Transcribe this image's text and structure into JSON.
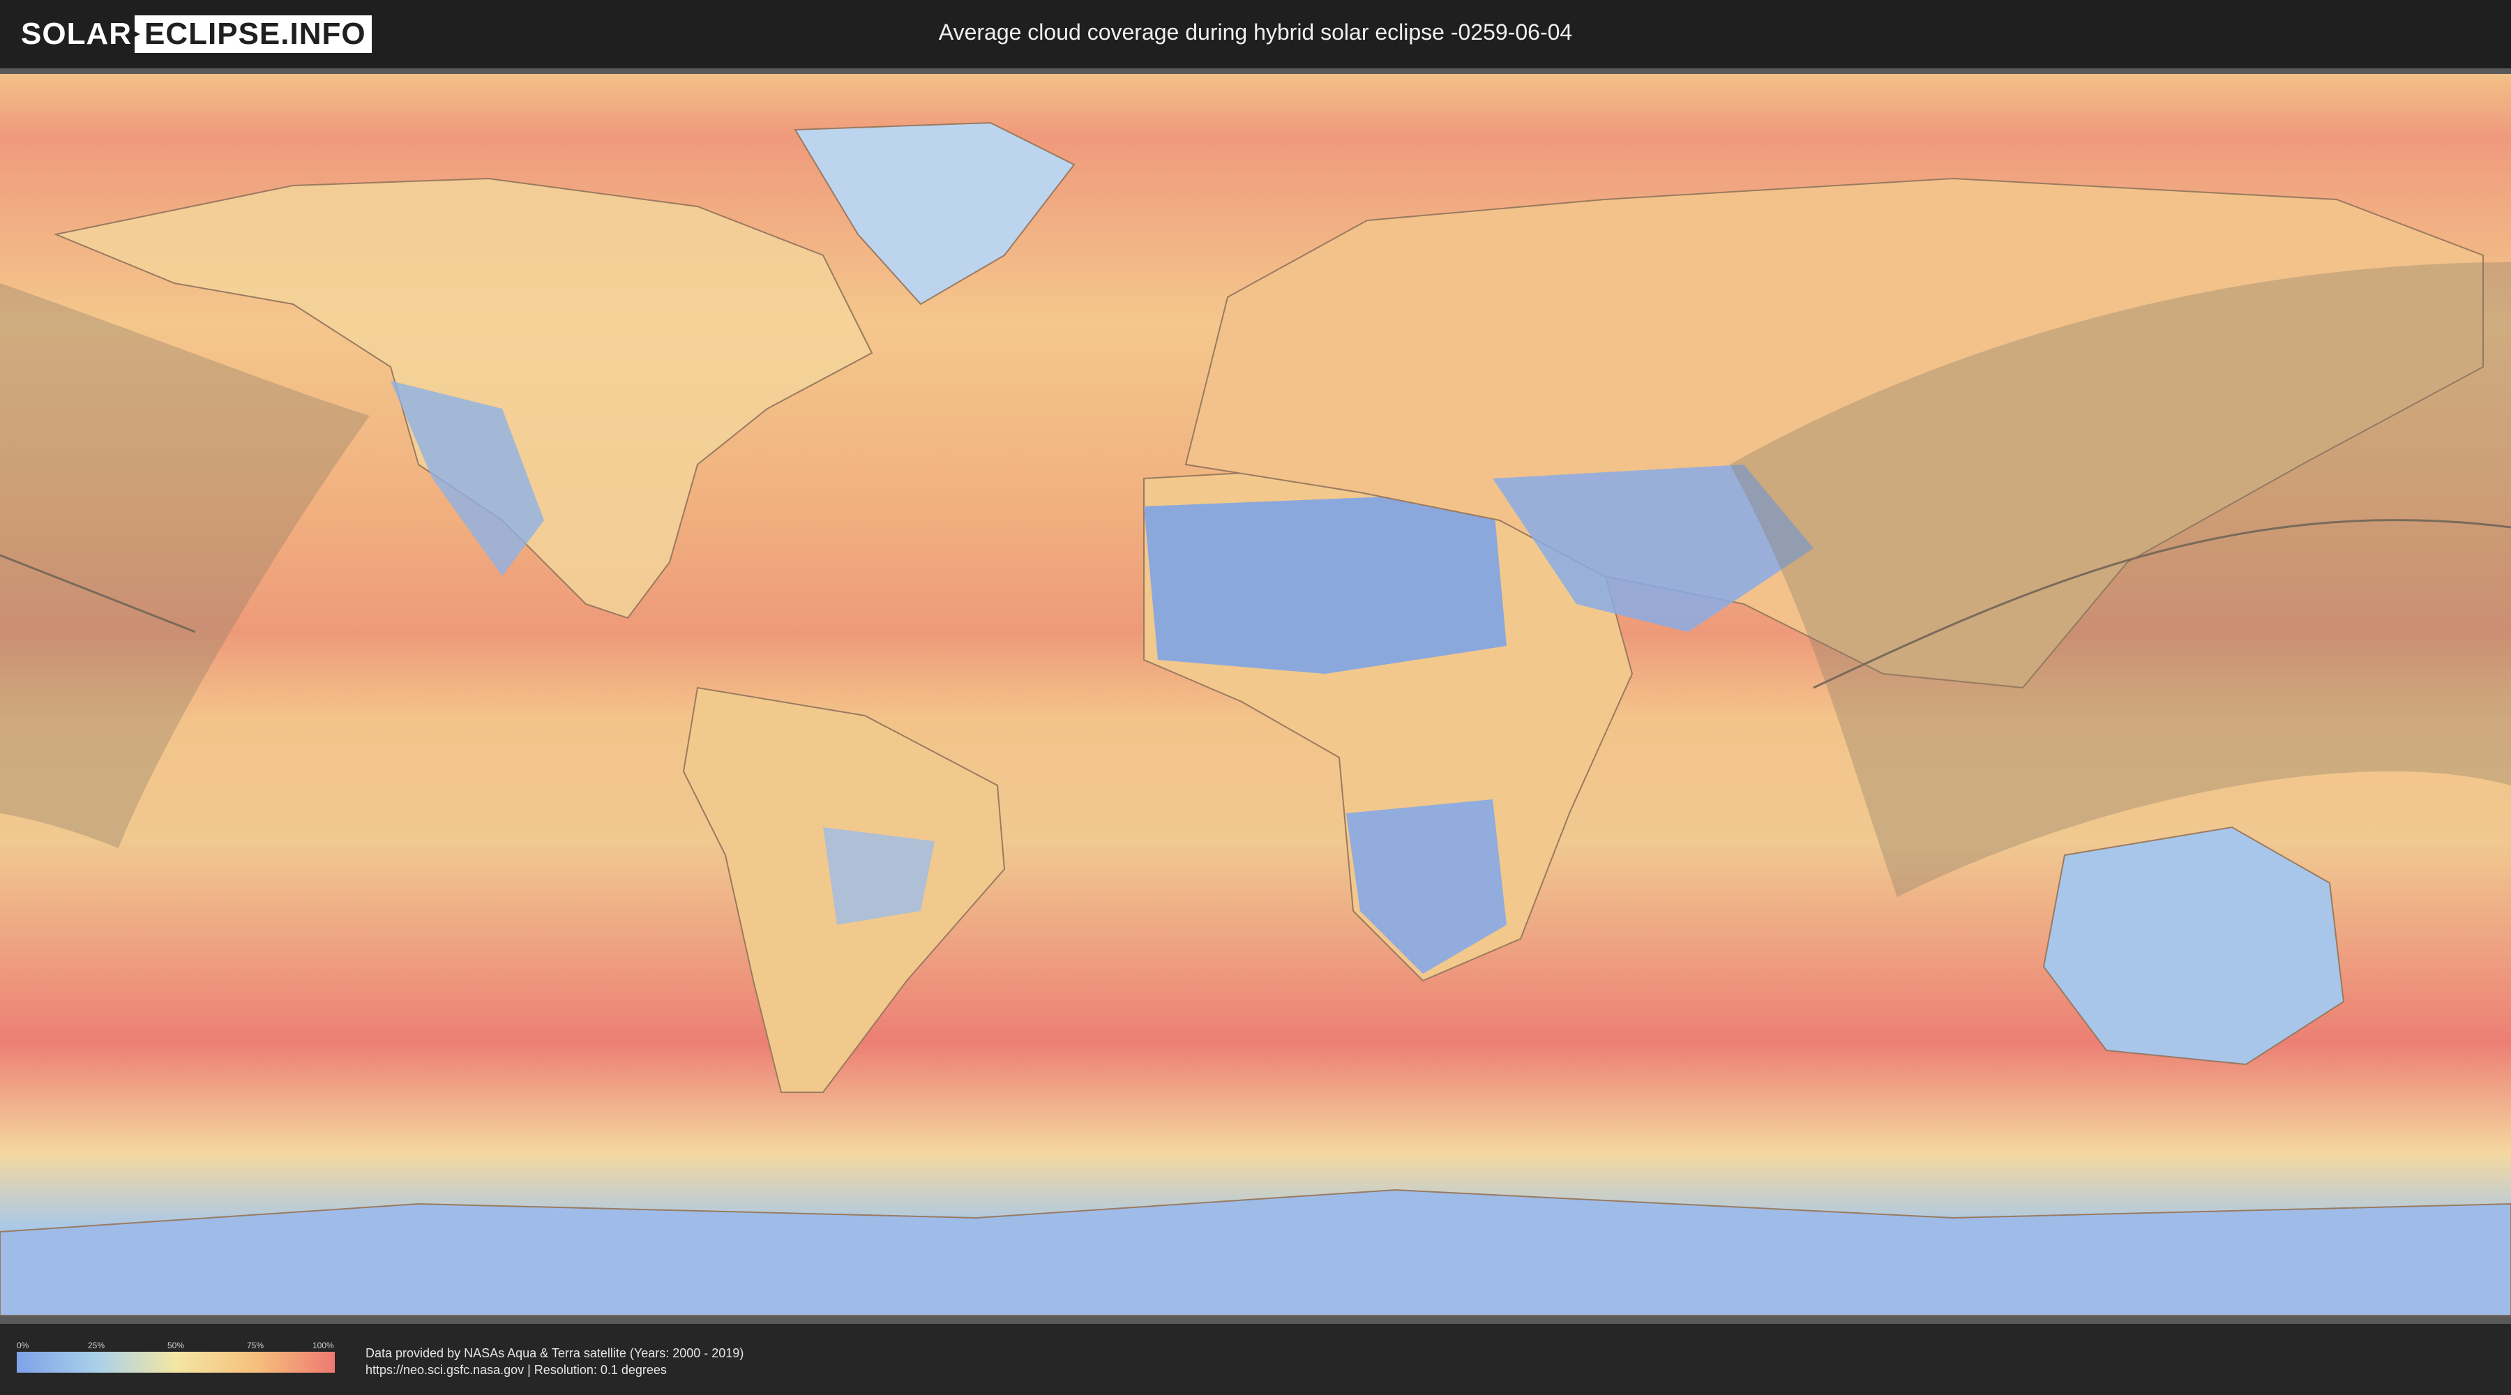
{
  "header": {
    "logo_solar": "SOLAR",
    "logo_eclipse": "ECLIPSE.INFO",
    "title": "Average cloud coverage during hybrid solar eclipse -0259-06-04"
  },
  "map": {
    "colors": {
      "clear": "#7ea2e8",
      "light": "#a9d0ea",
      "medium": "#f4e6a4",
      "heavy": "#f6c07c",
      "overcast": "#ee7a72",
      "eclipse_overlay": "#8a7a66",
      "border_line": "#7a6a5a"
    }
  },
  "legend": {
    "ticks": [
      "0%",
      "25%",
      "50%",
      "75%",
      "100%"
    ]
  },
  "footer": {
    "credit_line1": "Data provided by NASAs Aqua & Terra satellite (Years: 2000 - 2019)",
    "credit_line2": "https://neo.sci.gsfc.nasa.gov | Resolution: 0.1 degrees"
  }
}
